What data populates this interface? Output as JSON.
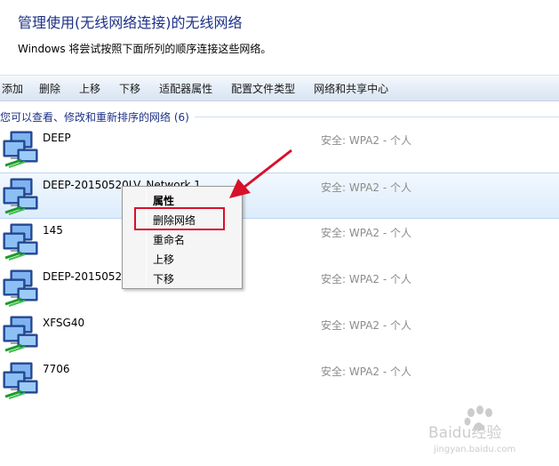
{
  "header": {
    "title": "管理使用(无线网络连接)的无线网络",
    "subtitle": "Windows 将尝试按照下面所列的顺序连接这些网络。"
  },
  "toolbar": {
    "add": "添加",
    "delete": "删除",
    "move_up": "上移",
    "move_down": "下移",
    "adapter_properties": "适配器属性",
    "profile_types": "配置文件类型",
    "network_center": "网络和共享中心"
  },
  "group": {
    "label": "您可以查看、修改和重新排序的网络 (6)"
  },
  "networks": [
    {
      "name": "DEEP",
      "security": "安全: WPA2 - 个人"
    },
    {
      "name": "DEEP-20150520LV_Network 1",
      "security": "安全: WPA2 - 个人",
      "selected": true
    },
    {
      "name": "145",
      "security": "安全: WPA2 - 个人"
    },
    {
      "name": "DEEP-20150520LV",
      "security": "安全: WPA2 - 个人"
    },
    {
      "name": "XFSG40",
      "security": "安全: WPA2 - 个人"
    },
    {
      "name": "7706",
      "security": "安全: WPA2 - 个人"
    }
  ],
  "context_menu": {
    "items": [
      "属性",
      "删除网络",
      "重命名",
      "上移",
      "下移"
    ]
  },
  "annotation_color": "#d8102a",
  "watermark": {
    "main": "Baidu经验",
    "sub": "jingyan.baidu.com"
  }
}
